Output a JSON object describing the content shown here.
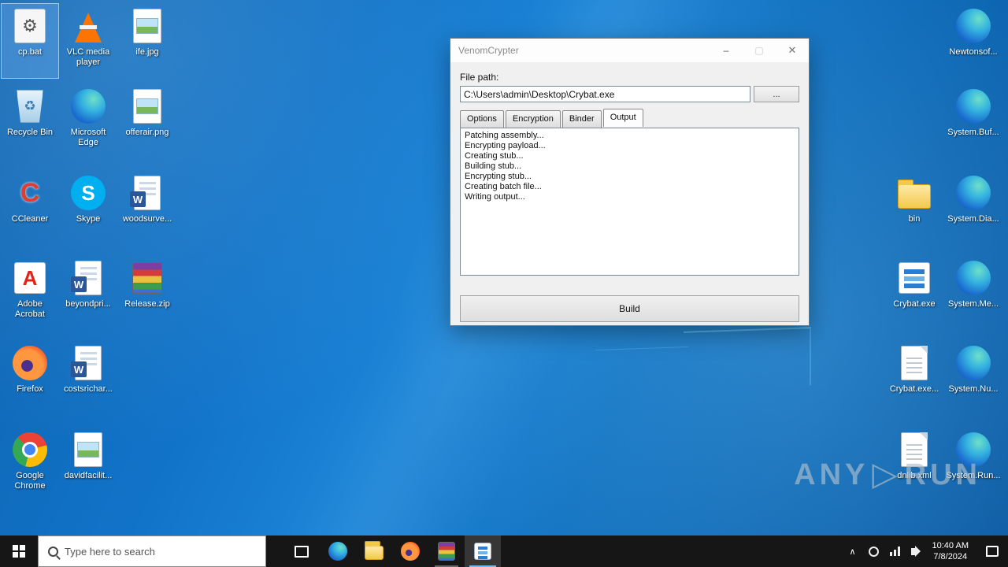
{
  "window": {
    "title": "VenomCrypter",
    "controls": {
      "minimize": "–",
      "maximize": "▢",
      "close": "✕"
    },
    "file_path_label": "File path:",
    "file_path_value": "C:\\Users\\admin\\Desktop\\Crybat.exe",
    "browse_button": "...",
    "tabs": [
      {
        "label": "Options",
        "selected": false
      },
      {
        "label": "Encryption",
        "selected": false
      },
      {
        "label": "Binder",
        "selected": false
      },
      {
        "label": "Output",
        "selected": true
      }
    ],
    "output_lines": [
      "Patching assembly...",
      "Encrypting payload...",
      "Creating stub...",
      "Building stub...",
      "Encrypting stub...",
      "Creating batch file...",
      "Writing output..."
    ],
    "build_button": "Build"
  },
  "desktop": {
    "left_icons": [
      {
        "label": "cp.bat",
        "icon": "batch-file",
        "selected": true
      },
      {
        "label": "VLC media player",
        "icon": "vlc-cone"
      },
      {
        "label": "ife.jpg",
        "icon": "image-file"
      },
      {
        "label": "Recycle Bin",
        "icon": "recycle-bin"
      },
      {
        "label": "Microsoft Edge",
        "icon": "edge-browser"
      },
      {
        "label": "offerair.png",
        "icon": "image-file"
      },
      {
        "label": "CCleaner",
        "icon": "ccleaner"
      },
      {
        "label": "Skype",
        "icon": "skype"
      },
      {
        "label": "woodsurve...",
        "icon": "word-document"
      },
      {
        "label": "Adobe Acrobat",
        "icon": "acrobat-pdf"
      },
      {
        "label": "beyondpri...",
        "icon": "word-document"
      },
      {
        "label": "Release.zip",
        "icon": "winrar-archive"
      },
      {
        "label": "Firefox",
        "icon": "firefox-browser"
      },
      {
        "label": "costsrichar...",
        "icon": "word-document"
      },
      {
        "label": "Google Chrome",
        "icon": "chrome-browser"
      },
      {
        "label": "davidfacilit...",
        "icon": "image-file"
      }
    ],
    "right_icons": [
      {
        "label": "Newtonsof...",
        "icon": "edge-style-library"
      },
      {
        "label": "System.Buf...",
        "icon": "edge-style-library"
      },
      {
        "label": "bin",
        "icon": "folder"
      },
      {
        "label": "System.Dia...",
        "icon": "edge-style-library"
      },
      {
        "label": "Crybat.exe",
        "icon": "application-executable"
      },
      {
        "label": "System.Me...",
        "icon": "edge-style-library"
      },
      {
        "label": "Crybat.exe...",
        "icon": "text-document"
      },
      {
        "label": "System.Nu...",
        "icon": "edge-style-library"
      },
      {
        "label": "dnlib.xml",
        "icon": "text-document"
      },
      {
        "label": "System.Run...",
        "icon": "edge-style-library"
      }
    ]
  },
  "taskbar": {
    "search_placeholder": "Type here to search",
    "clock_time": "10:40 AM",
    "clock_date": "7/8/2024"
  },
  "watermark": {
    "left": "ANY",
    "logo": "▷",
    "right": "RUN"
  }
}
